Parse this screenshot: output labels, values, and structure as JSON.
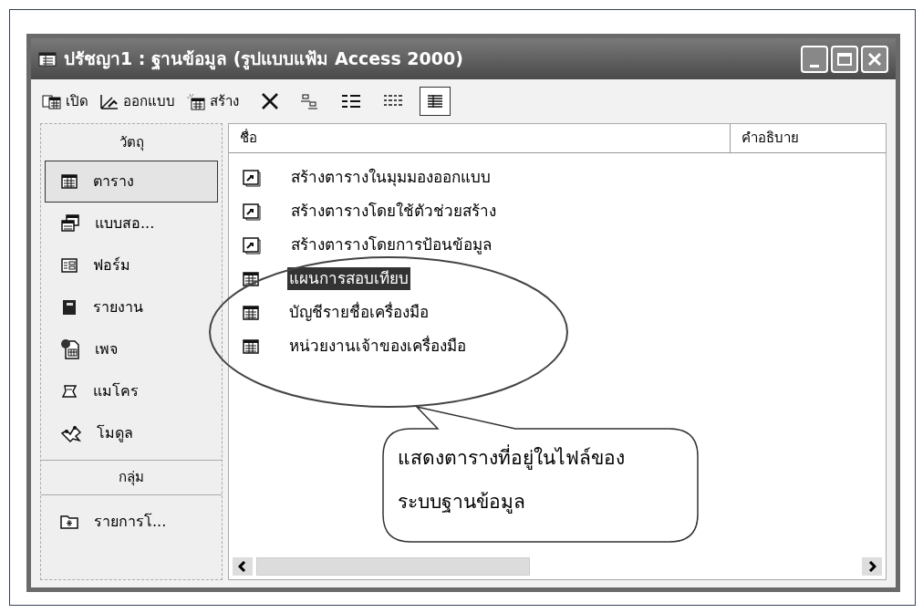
{
  "window": {
    "title": "ปรัชญา1 : ฐานข้อมูล (รูปแบบแฟ้ม Access 2000)"
  },
  "toolbar": [
    {
      "kind": "open",
      "label": "เปิด"
    },
    {
      "kind": "design",
      "label": "ออกแบบ"
    },
    {
      "kind": "new",
      "label": "สร้าง"
    },
    {
      "kind": "delete"
    },
    {
      "kind": "large-icons",
      "selected": false
    },
    {
      "kind": "small-icons",
      "selected": false
    },
    {
      "kind": "list",
      "selected": false
    },
    {
      "kind": "details",
      "selected": true
    }
  ],
  "sidebar": {
    "objects_header": "วัตถุ",
    "items": [
      {
        "kind": "table",
        "label": "ตาราง",
        "selected": true
      },
      {
        "kind": "query",
        "label": "แบบสอ...",
        "selected": false
      },
      {
        "kind": "form",
        "label": "ฟอร์ม",
        "selected": false
      },
      {
        "kind": "report",
        "label": "รายงาน",
        "selected": false
      },
      {
        "kind": "page",
        "label": "เพจ",
        "selected": false
      },
      {
        "kind": "macro",
        "label": "แมโคร",
        "selected": false
      },
      {
        "kind": "module",
        "label": "โมดูล",
        "selected": false
      }
    ],
    "groups_header": "กลุ่ม",
    "groups": [
      {
        "kind": "favorites",
        "label": "รายการโ..."
      }
    ]
  },
  "list": {
    "columns": [
      "ชื่อ",
      "คำอธิบาย"
    ],
    "rows": [
      {
        "kind": "shortcut",
        "name": "สร้างตารางในมุมมองออกแบบ",
        "selected": false
      },
      {
        "kind": "shortcut",
        "name": "สร้างตารางโดยใช้ตัวช่วยสร้าง",
        "selected": false
      },
      {
        "kind": "shortcut",
        "name": "สร้างตารางโดยการป้อนข้อมูล",
        "selected": false
      },
      {
        "kind": "table",
        "name": "แผนการสอบเทียบ",
        "selected": true
      },
      {
        "kind": "table",
        "name": "บัญชีรายชื่อเครื่องมือ",
        "selected": false
      },
      {
        "kind": "table",
        "name": "หน่วยงานเจ้าของเครื่องมือ",
        "selected": false
      }
    ]
  },
  "callout": {
    "lines": [
      "แสดงตารางที่อยู่ในไฟล์ของ",
      "ระบบฐานข้อมูล"
    ]
  }
}
